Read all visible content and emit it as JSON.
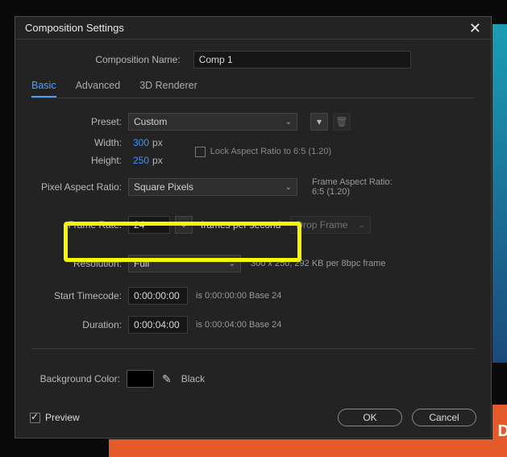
{
  "dialog_title": "Composition Settings",
  "comp_name_label": "Composition Name:",
  "comp_name_value": "Comp 1",
  "tabs": {
    "basic": "Basic",
    "advanced": "Advanced",
    "renderer": "3D Renderer"
  },
  "preset": {
    "label": "Preset:",
    "value": "Custom"
  },
  "width": {
    "label": "Width:",
    "value": "300",
    "unit": "px"
  },
  "height": {
    "label": "Height:",
    "value": "250",
    "unit": "px"
  },
  "lock_ratio": "Lock Aspect Ratio to 6:5 (1.20)",
  "par": {
    "label": "Pixel Aspect Ratio:",
    "value": "Square Pixels"
  },
  "far": {
    "label": "Frame Aspect Ratio:",
    "value": "6:5 (1.20)"
  },
  "frame_rate": {
    "label": "Frame Rate:",
    "value": "24",
    "unit": "frames per second",
    "drop": "Drop Frame"
  },
  "resolution": {
    "label": "Resolution:",
    "value": "Full",
    "info": "300 x 250, 292 KB per 8bpc frame"
  },
  "start_tc": {
    "label": "Start Timecode:",
    "value": "0:00:00:00",
    "info": "is 0:00:00:00  Base 24"
  },
  "duration": {
    "label": "Duration:",
    "value": "0:00:04:00",
    "info": "is 0:00:04:00  Base 24"
  },
  "bg_color": {
    "label": "Background Color:",
    "name": "Black",
    "hex": "#000000"
  },
  "preview_label": "Preview",
  "buttons": {
    "ok": "OK",
    "cancel": "Cancel"
  }
}
